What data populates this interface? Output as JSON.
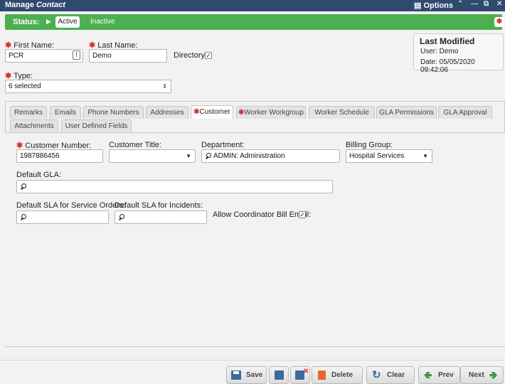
{
  "window": {
    "title_prefix": "Manage",
    "title_entity": "Contact",
    "options_label": "Options"
  },
  "status": {
    "label": "Status:",
    "active": "Active",
    "inactive": "Inactive"
  },
  "form": {
    "first_name_label": "First Name:",
    "first_name_value": "PCR",
    "last_name_label": "Last Name:",
    "last_name_value": "Demo",
    "directory_label": "Directory:",
    "directory_checked": true,
    "type_label": "Type:",
    "type_value": "6 selected"
  },
  "last_modified": {
    "heading": "Last Modified",
    "user_line": "User: Demo",
    "date_line": "Date: 05/05/2020 09:42:06"
  },
  "tabs": {
    "row1": [
      {
        "label": "Remarks"
      },
      {
        "label": "Emails"
      },
      {
        "label": "Phone Numbers"
      },
      {
        "label": "Addresses"
      },
      {
        "label": "Customer",
        "required": true,
        "selected": true
      },
      {
        "label": "Worker Workgroup",
        "required": true
      },
      {
        "label": "Worker Schedule"
      },
      {
        "label": "GLA Permissions"
      },
      {
        "label": "GLA Approval"
      }
    ],
    "row2": [
      {
        "label": "Attachments"
      },
      {
        "label": "User Defined Fields"
      }
    ]
  },
  "customer": {
    "number_label": "Customer Number:",
    "number_value": "1987886456",
    "title_label": "Customer Title:",
    "title_value": "",
    "department_label": "Department:",
    "department_value": "ADMIN: Administration",
    "billing_label": "Billing Group:",
    "billing_value": "Hospital Services",
    "default_gla_label": "Default GLA:",
    "sla_service_label": "Default SLA for Service Orders:",
    "sla_incident_label": "Default SLA for Incidents:",
    "allow_bill_email_label": "Allow Coordinator Bill Email:",
    "allow_bill_email_checked": true
  },
  "footer": {
    "save": "Save",
    "delete": "Delete",
    "clear": "Clear",
    "prev": "Prev",
    "next": "Next"
  },
  "colors": {
    "titlebar": "#2f4a6e",
    "status_bar": "#4caf50",
    "required": "#d32f2f"
  }
}
